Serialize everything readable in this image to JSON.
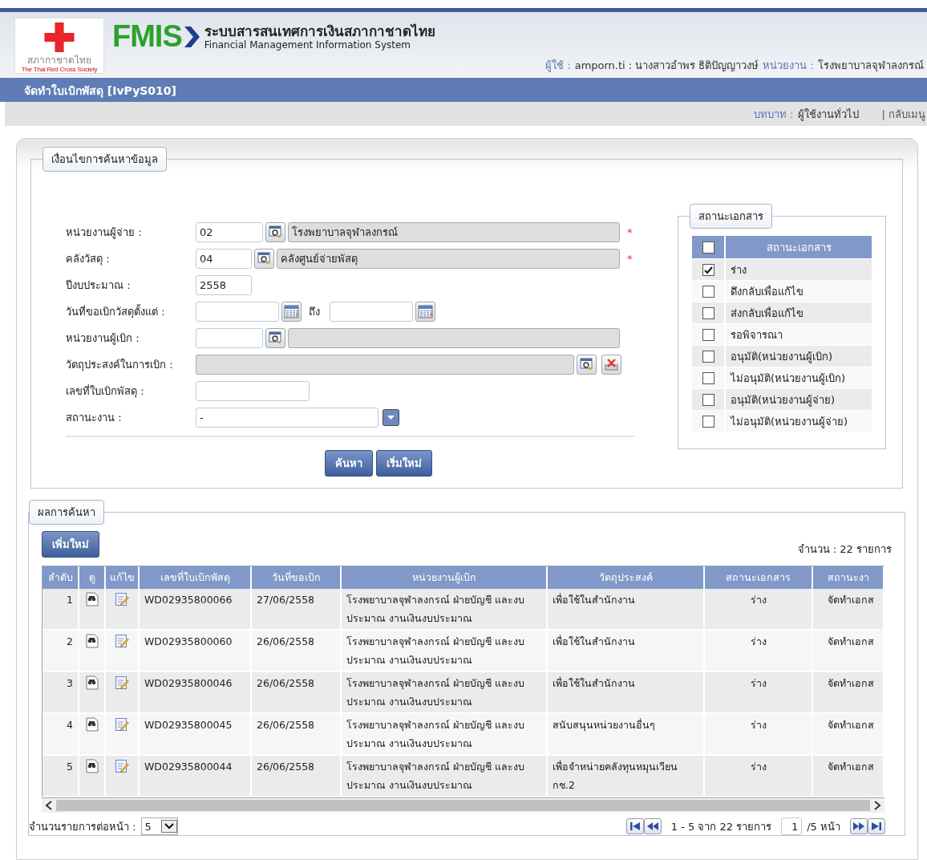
{
  "header": {
    "logo": {
      "name": "สภากาชาดไทย",
      "subtitle": "The Thai Red Cross Society"
    },
    "system": {
      "acronym": "FMIS",
      "thai_name": "ระบบสารสนเทศการเงินสภากาชาดไทย",
      "english_name": "Financial Management Information System"
    },
    "user": {
      "user_label": "ผู้ใช้ :",
      "user_value": "amporn.ti : นางสาวอำพร ธิติปัญญาวงษ์",
      "unit_label": "หน่วยงาน :",
      "unit_value": "โรงพยาบาลจุฬาลงกรณ์"
    }
  },
  "title_bar": "จัดทำใบเบิกพัสดุ [IvPyS010]",
  "role_bar": {
    "role_label": "บทบาท :",
    "role_value": "ผู้ใช้งานทั่วไป",
    "back_link": "| กลับเมนู"
  },
  "search": {
    "legend": "เงื่อนไขการค้นหาข้อมูล",
    "fields": [
      {
        "kind": "lookup",
        "label": "หน่วยงานผู้จ่าย :",
        "code": "02",
        "name": "โรงพยาบาลจุฬาลงกรณ์",
        "required": true
      },
      {
        "kind": "lookup",
        "label": "คลังวัสดุ :",
        "code": "04",
        "name": "คลังศูนย์จ่ายพัสดุ",
        "required": true
      },
      {
        "kind": "number",
        "label": "ปีงบประมาณ :",
        "value": "2558"
      },
      {
        "kind": "date_range",
        "label": "วันที่ขอเบิกวัสดุตั้งแต่ :",
        "separator": "ถึง"
      },
      {
        "kind": "lookup",
        "label": "หน่วยงานผู้เบิก :",
        "required": false
      },
      {
        "kind": "purpose",
        "label": "วัตถุประสงค์ในการเบิก :"
      },
      {
        "kind": "text",
        "label": "เลขที่ใบเบิกพัสดุ :"
      },
      {
        "kind": "select",
        "label": "สถานะงาน :",
        "value": "-"
      }
    ],
    "required_mark": "*",
    "buttons": [
      "ค้นหา",
      "เริ่มใหม่"
    ],
    "status_panel": {
      "legend": "สถานะเอกสาร",
      "header_label": "สถานะเอกสาร",
      "all_checked": false,
      "items": [
        {
          "label": "ร่าง",
          "checked": true
        },
        {
          "label": "ดึงกลับเพื่อแก้ไข",
          "checked": false
        },
        {
          "label": "ส่งกลับเพื่อแก้ไข",
          "checked": false
        },
        {
          "label": "รอพิจารณา",
          "checked": false
        },
        {
          "label": "อนุมัติ(หน่วยงานผู้เบิก)",
          "checked": false
        },
        {
          "label": "ไม่อนุมัติ(หน่วยงานผู้เบิก)",
          "checked": false
        },
        {
          "label": "อนุมัติ(หน่วยงานผู้จ่าย)",
          "checked": false
        },
        {
          "label": "ไม่อนุมัติ(หน่วยงานผู้จ่าย)",
          "checked": false
        }
      ]
    }
  },
  "results": {
    "legend": "ผลการค้นหา",
    "add_button": "เพิ่มใหม่",
    "count": "จำนวน : 22 รายการ",
    "columns": [
      "ลำดับ",
      "ดู",
      "แก้ไข",
      "เลขที่ใบเบิกพัสดุ",
      "วันที่ขอเบิก",
      "หน่วยงานผู้เบิก",
      "วัตถุประสงค์",
      "สถานะเอกสาร",
      "สถานะงา"
    ],
    "rows": [
      {
        "no": "1",
        "doc_no": "WD02935800066",
        "date": "27/06/2558",
        "unit": "โรงพยาบาลจุฬาลงกรณ์ ฝ่ายบัญชี และงบประมาณ งานเงินงบประมาณ",
        "purpose": "เพื่อใช้ในสำนักงาน",
        "doc_status": "ร่าง",
        "job_status": "จัดทำเอกส"
      },
      {
        "no": "2",
        "doc_no": "WD02935800060",
        "date": "26/06/2558",
        "unit": "โรงพยาบาลจุฬาลงกรณ์ ฝ่ายบัญชี และงบประมาณ งานเงินงบประมาณ",
        "purpose": "เพื่อใช้ในสำนักงาน",
        "doc_status": "ร่าง",
        "job_status": "จัดทำเอกส"
      },
      {
        "no": "3",
        "doc_no": "WD02935800046",
        "date": "26/06/2558",
        "unit": "โรงพยาบาลจุฬาลงกรณ์ ฝ่ายบัญชี และงบประมาณ งานเงินงบประมาณ",
        "purpose": "เพื่อใช้ในสำนักงาน",
        "doc_status": "ร่าง",
        "job_status": "จัดทำเอกส"
      },
      {
        "no": "4",
        "doc_no": "WD02935800045",
        "date": "26/06/2558",
        "unit": "โรงพยาบาลจุฬาลงกรณ์ ฝ่ายบัญชี และงบประมาณ งานเงินงบประมาณ",
        "purpose": "สนับสนุนหน่วยงานอื่นๆ",
        "doc_status": "ร่าง",
        "job_status": "จัดทำเอกส"
      },
      {
        "no": "5",
        "doc_no": "WD02935800044",
        "date": "26/06/2558",
        "unit": "โรงพยาบาลจุฬาลงกรณ์ ฝ่ายบัญชี และงบประมาณ งานเงินงบประมาณ",
        "purpose": "เพื่อจำหน่ายคลังทุนหมุนเวียน กช.2",
        "doc_status": "ร่าง",
        "job_status": "จัดทำเอกส"
      }
    ],
    "pager": {
      "page_size_label": "จำนวนรายการต่อหน้า :",
      "page_size": "5",
      "range": "1 - 5 จาก 22 รายการ",
      "page": "1",
      "total_pages": "/5 หน้า"
    }
  }
}
